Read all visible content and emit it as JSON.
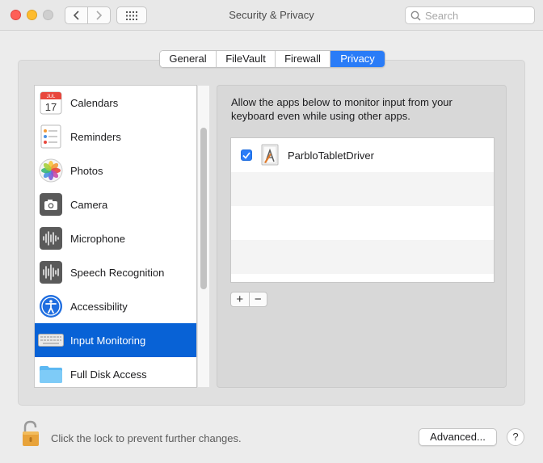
{
  "window": {
    "title": "Security & Privacy"
  },
  "toolbar": {
    "back_icon": "chevron-left-icon",
    "forward_icon": "chevron-right-icon",
    "grid_icon": "show-all-grid-icon",
    "search_placeholder": "Search",
    "search_value": ""
  },
  "tabs": [
    {
      "label": "General",
      "selected": false
    },
    {
      "label": "FileVault",
      "selected": false
    },
    {
      "label": "Firewall",
      "selected": false
    },
    {
      "label": "Privacy",
      "selected": true
    }
  ],
  "sidebar": {
    "items": [
      {
        "label": "Calendars",
        "icon": "calendar-icon",
        "icon_text": "JUL 17",
        "selected": false
      },
      {
        "label": "Reminders",
        "icon": "reminders-icon",
        "selected": false
      },
      {
        "label": "Photos",
        "icon": "photos-icon",
        "selected": false
      },
      {
        "label": "Camera",
        "icon": "camera-icon",
        "selected": false
      },
      {
        "label": "Microphone",
        "icon": "microphone-waveform-icon",
        "selected": false
      },
      {
        "label": "Speech Recognition",
        "icon": "speech-waveform-icon",
        "selected": false
      },
      {
        "label": "Accessibility",
        "icon": "accessibility-icon",
        "selected": false
      },
      {
        "label": "Input Monitoring",
        "icon": "keyboard-icon",
        "selected": true
      },
      {
        "label": "Full Disk Access",
        "icon": "folder-icon",
        "selected": false
      }
    ]
  },
  "main": {
    "description": "Allow the apps below to monitor input from your keyboard even while using other apps.",
    "apps": [
      {
        "name": "ParbloTabletDriver",
        "checked": true,
        "icon": "app-generic-icon"
      }
    ],
    "add_label": "+",
    "remove_label": "−"
  },
  "footer": {
    "lock_text": "Click the lock to prevent further changes.",
    "advanced_label": "Advanced...",
    "help_label": "?"
  },
  "colors": {
    "accent": "#2a7cf7",
    "selection": "#0862d6",
    "close": "#fe5f57",
    "minimize": "#febc2e"
  }
}
